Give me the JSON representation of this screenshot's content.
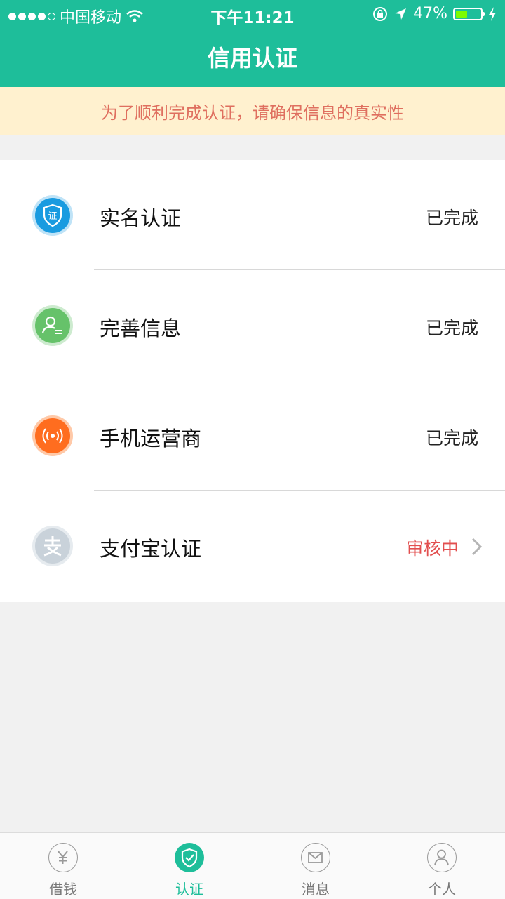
{
  "status_bar": {
    "carrier": "中国移动",
    "time": "下午11:21",
    "battery": "47%",
    "battery_level": 0.47,
    "icons": [
      "signal-dots-icon",
      "wifi-icon",
      "rotation-lock-icon",
      "location-arrow-icon",
      "battery-icon",
      "charging-bolt-icon"
    ]
  },
  "nav": {
    "title": "信用认证"
  },
  "notice": {
    "text": "为了顺利完成认证，请确保信息的真实性"
  },
  "items": [
    {
      "label": "实名认证",
      "status": "已完成",
      "icon": "id-shield-icon",
      "color": "#1a9be0"
    },
    {
      "label": "完善信息",
      "status": "已完成",
      "icon": "user-info-icon",
      "color": "#66c26a"
    },
    {
      "label": "手机运营商",
      "status": "已完成",
      "icon": "signal-broadcast-icon",
      "color": "#ff6d1f"
    },
    {
      "label": "支付宝认证",
      "status": "审核中",
      "icon": "alipay-icon",
      "color": "#c9d2da"
    }
  ],
  "tabs": [
    {
      "label": "借钱",
      "icon": "yuan-icon",
      "active": false
    },
    {
      "label": "认证",
      "icon": "shield-check-icon",
      "active": true
    },
    {
      "label": "消息",
      "icon": "mail-icon",
      "active": false
    },
    {
      "label": "个人",
      "icon": "person-icon",
      "active": false
    }
  ],
  "colors": {
    "primary": "#1ebe9a",
    "notice_bg": "#fff1cf",
    "notice_text": "#df6f5f",
    "pending": "#e24f4f"
  }
}
